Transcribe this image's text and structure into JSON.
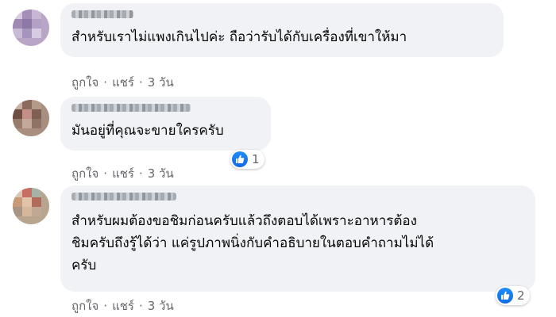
{
  "comments": [
    {
      "text": "สำหรับเราไม่แพงเกินไปค่ะ ถือว่ารับได้กับเครื่องที่เขาให้มา",
      "actions": {
        "like": "ถูกใจ",
        "reply": "แชร์",
        "time": "3 วัน"
      },
      "reaction_count": null
    },
    {
      "text": "มันอยู่ที่คุณจะขายใครครับ",
      "actions": {
        "like": "ถูกใจ",
        "reply": "แชร์",
        "time": "3 วัน"
      },
      "reaction_count": "1"
    },
    {
      "text": "สำหรับผมต้องขอชิมก่อนครับแล้วถึงตอบได้เพราะอาหารต้อง\nชิมครับถึงรู้ได้ว่า แค่รูปภาพนิ่งกับคำอธิบายในตอบคำถามไม่ได้\nครับ",
      "actions": {
        "like": "ถูกใจ",
        "reply": "แชร์",
        "time": "3 วัน"
      },
      "reaction_count": "2"
    }
  ],
  "separator": "·",
  "colors": {
    "bubble": "#f0f2f5",
    "meta_text": "#65676b",
    "like_blue": "#1877f2"
  },
  "icons": {
    "reaction": "like-thumb-icon"
  }
}
